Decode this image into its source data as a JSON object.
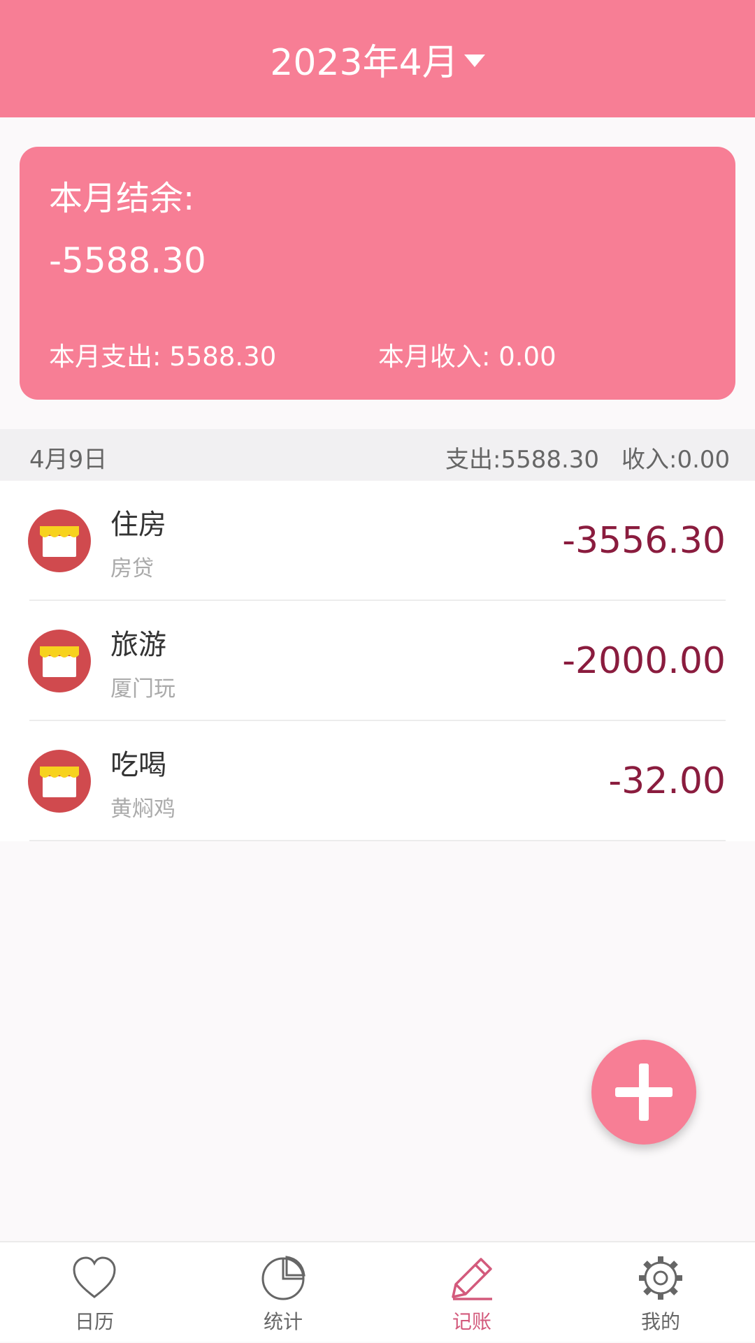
{
  "header": {
    "month": "2023年4月"
  },
  "summary": {
    "label": "本月结余:",
    "balance": "-5588.30",
    "expense": "本月支出: 5588.30",
    "income": "本月收入: 0.00"
  },
  "day_group": {
    "date": "4月9日",
    "expense": "支出:5588.30",
    "income": "收入:0.00"
  },
  "transactions": [
    {
      "category": "住房",
      "note": "房贷",
      "amount": "-3556.30",
      "icon": "shop-icon"
    },
    {
      "category": "旅游",
      "note": "厦门玩",
      "amount": "-2000.00",
      "icon": "shop-icon"
    },
    {
      "category": "吃喝",
      "note": "黄焖鸡",
      "amount": "-32.00",
      "icon": "shop-icon"
    }
  ],
  "fab": {
    "icon": "plus-icon"
  },
  "tabs": [
    {
      "label": "日历",
      "icon": "heart-icon"
    },
    {
      "label": "统计",
      "icon": "pie-chart-icon"
    },
    {
      "label": "记账",
      "icon": "pencil-icon",
      "active": true
    },
    {
      "label": "我的",
      "icon": "gear-icon"
    }
  ],
  "colors": {
    "accent": "#f77e95",
    "amount": "#8a1c3e",
    "active_tab": "#d35a7c",
    "icon_red": "#d04a4e",
    "icon_yellow": "#f7d21e"
  }
}
